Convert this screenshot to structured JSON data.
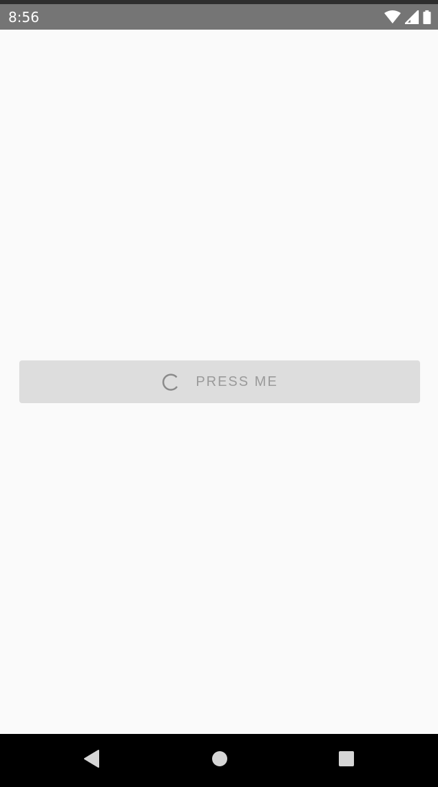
{
  "status_bar": {
    "time": "8:56",
    "icons": [
      "wifi-icon",
      "cellular-signal-icon",
      "battery-icon"
    ]
  },
  "main": {
    "button": {
      "label": "PRESS ME",
      "state": "loading",
      "spinner_icon": "progress-spinner-icon"
    }
  },
  "nav_bar": {
    "buttons": [
      "back-icon",
      "home-icon",
      "recents-icon"
    ]
  },
  "colors": {
    "status_bar_bg": "#757575",
    "background": "#fafafa",
    "button_bg": "#dddddd",
    "button_text": "#9a9a9a",
    "nav_bar_bg": "#000000"
  }
}
